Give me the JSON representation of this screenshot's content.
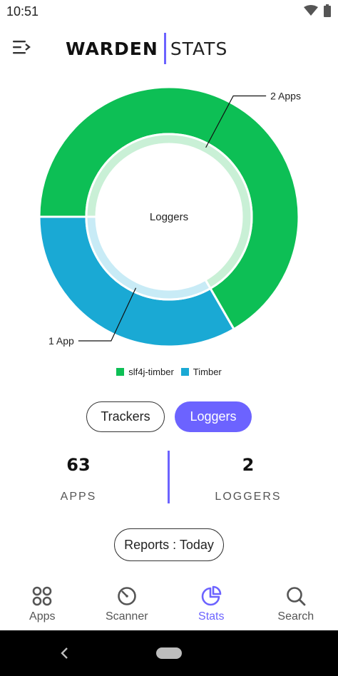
{
  "status_bar": {
    "time": "10:51",
    "icons": [
      "wifi-icon",
      "battery-icon"
    ]
  },
  "header": {
    "menu_icon": "menu-collapse-icon",
    "logo_bold": "WARDEN",
    "logo_light": "STATS",
    "accent_color": "#6c63ff"
  },
  "chart_data": {
    "type": "pie",
    "title": "Loggers",
    "center_label": "Loggers",
    "series": [
      {
        "name": "slf4j-timber",
        "value": 2,
        "label": "2 Apps",
        "color": "#0dbf55",
        "inner_color": "#c9f0d6"
      },
      {
        "name": "Timber",
        "value": 1,
        "label": "1 App",
        "color": "#1aa9d4",
        "inner_color": "#c8ebf6"
      }
    ],
    "legend_position": "bottom-center"
  },
  "legend": [
    {
      "label": "slf4j-timber",
      "color": "#0dbf55"
    },
    {
      "label": "Timber",
      "color": "#1aa9d4"
    }
  ],
  "toggle": {
    "trackers_label": "Trackers",
    "loggers_label": "Loggers",
    "active": "Loggers"
  },
  "stats": {
    "apps_value": "63",
    "apps_label": "APPS",
    "loggers_value": "2",
    "loggers_label": "LOGGERS"
  },
  "report_button": {
    "label": "Reports : Today"
  },
  "bottom_nav": {
    "items": [
      {
        "label": "Apps",
        "icon": "apps-grid-icon"
      },
      {
        "label": "Scanner",
        "icon": "scanner-icon"
      },
      {
        "label": "Stats",
        "icon": "pie-chart-icon"
      },
      {
        "label": "Search",
        "icon": "search-icon"
      }
    ],
    "active": "Stats",
    "active_color": "#6c63ff",
    "inactive_color": "#555555"
  },
  "system_nav": {
    "icons": [
      "back-icon",
      "home-pill-icon"
    ]
  }
}
